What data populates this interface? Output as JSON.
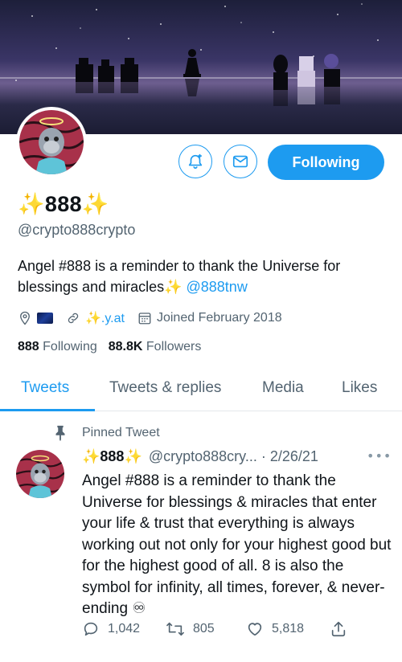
{
  "profile": {
    "name": "✨888✨",
    "handle": "@crypto888crypto",
    "bio_text": "Angel #888 is a reminder to thank the Universe for blessings and miracles✨ ",
    "bio_link": "@888tnw",
    "website": "✨.y.at",
    "joined": "Joined February 2018",
    "following_count": "888",
    "following_label": "Following",
    "followers_count": "88.8K",
    "followers_label": "Followers"
  },
  "header_actions": {
    "follow_label": "Following",
    "notify_icon": "bell-plus-icon",
    "message_icon": "envelope-icon"
  },
  "tabs": [
    {
      "label": "Tweets",
      "active": true
    },
    {
      "label": "Tweets & replies",
      "active": false
    },
    {
      "label": "Media",
      "active": false
    },
    {
      "label": "Likes",
      "active": false
    }
  ],
  "tweet": {
    "pinned_label": "Pinned Tweet",
    "name": "✨888✨",
    "handle_date": "@crypto888cry... · 2/26/21",
    "more": "•••",
    "text": "Angel #888 is a reminder to thank the Universe for blessings & miracles that enter your life & trust that everything is always working out not only for your highest good but for the highest good of all. 8 is also the symbol for infinity, all times, forever, & never-ending ♾",
    "replies": "1,042",
    "retweets": "805",
    "likes": "5,818"
  },
  "colors": {
    "accent": "#1d9bf0",
    "secondary_text": "#536471"
  }
}
